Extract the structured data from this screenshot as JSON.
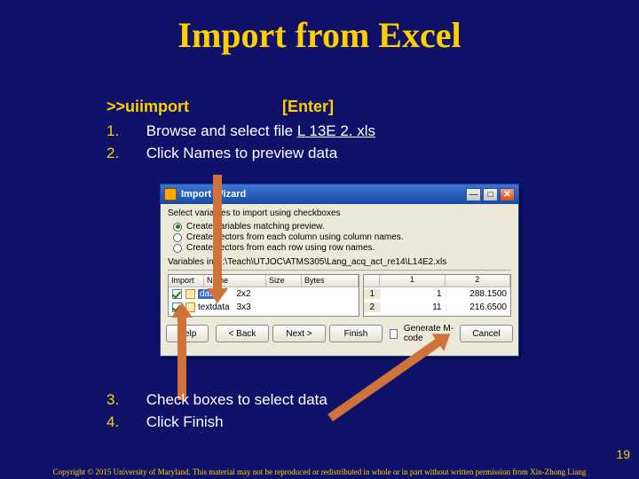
{
  "title": "Import from Excel",
  "command": {
    "prompt": ">>",
    "cmd": "uiimport",
    "key": "[Enter]"
  },
  "steps_top": [
    {
      "num": "1.",
      "pre": "Browse and select file ",
      "link": "L 13E 2. xls",
      "post": ""
    },
    {
      "num": "2.",
      "pre": "Click Names to preview data",
      "link": "",
      "post": ""
    }
  ],
  "steps_bottom": [
    {
      "num": "3.",
      "text": "Check boxes to select data"
    },
    {
      "num": "4.",
      "text": "Click Finish"
    }
  ],
  "wizard": {
    "title": "Import Wizard",
    "section": "Select variables to import using checkboxes",
    "radios": [
      {
        "label": "Create variables matching preview.",
        "selected": true
      },
      {
        "label": "Create vectors from each column using column names.",
        "selected": false
      },
      {
        "label": "Create vectors from each row using row names.",
        "selected": false
      }
    ],
    "var_line": "Variables in D:\\Teach\\UTJOC\\ATMS305\\Lang_acq_act_re14\\L14E2.xls",
    "list_headers": {
      "c1": "Import",
      "c2": "Name",
      "c3": "Size",
      "c4": "Bytes"
    },
    "rows": [
      {
        "checked": true,
        "name": "data",
        "size": "2x2",
        "highlight": true
      },
      {
        "checked": true,
        "name": "textdata",
        "size": "3x3",
        "highlight": false
      }
    ],
    "preview_headers": [
      "",
      "1",
      "2"
    ],
    "preview_rows": [
      {
        "r": "1",
        "a": "1",
        "b": "288.1500"
      },
      {
        "r": "2",
        "a": "11",
        "b": "216.6500"
      }
    ],
    "buttons": {
      "help": "Help",
      "back": "< Back",
      "next": "Next >",
      "finish": "Finish",
      "gen": "Generate M-code",
      "cancel": "Cancel"
    }
  },
  "page_number": "19",
  "copyright": "Copyright © 2015 University of Maryland. This material may not be reproduced or redistributed in whole or in part without written permission from Xin-Zhong Liang"
}
